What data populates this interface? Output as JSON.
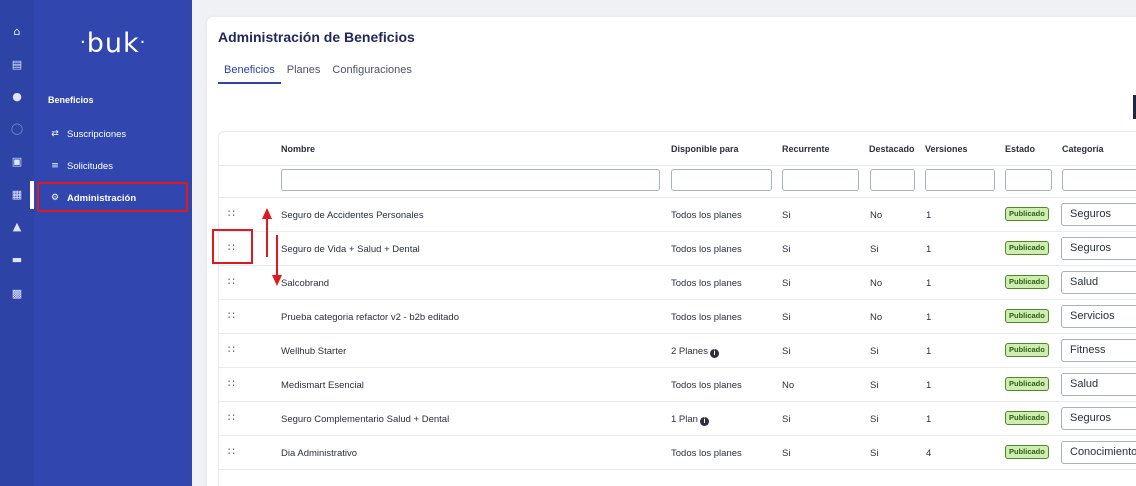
{
  "rail": {
    "icons": [
      "home-icon",
      "document-icon",
      "dollar-icon",
      "clock-icon",
      "puzzle-icon",
      "briefcase-icon",
      "graduation-icon",
      "folder-icon",
      "store-icon"
    ]
  },
  "sidebar": {
    "logo": "buk",
    "section_title": "Beneficios",
    "items": [
      {
        "label": "Suscripciones",
        "icon": "swap-icon"
      },
      {
        "label": "Solicitudes",
        "icon": "list-icon"
      },
      {
        "label": "Administración",
        "icon": "gear-icon"
      }
    ]
  },
  "page": {
    "title": "Administración de Beneficios",
    "tabs": [
      "Beneficios",
      "Planes",
      "Configuraciones"
    ],
    "active_tab": "Beneficios"
  },
  "table": {
    "headers": {
      "nombre": "Nombre",
      "disponible": "Disponible para",
      "recurrente": "Recurrente",
      "destacado": "Destacado",
      "versiones": "Versiones",
      "estado": "Estado",
      "categoria": "Categoría"
    },
    "rows": [
      {
        "nombre": "Seguro de Accidentes Personales",
        "disponible": "Todos los planes",
        "info": false,
        "recurrente": "Si",
        "destacado": "No",
        "versiones": "1",
        "estado": "Publicado",
        "categoria": "Seguros"
      },
      {
        "nombre": "Seguro de Vida + Salud + Dental",
        "disponible": "Todos los planes",
        "info": false,
        "recurrente": "Si",
        "destacado": "Si",
        "versiones": "1",
        "estado": "Publicado",
        "categoria": "Seguros"
      },
      {
        "nombre": "Salcobrand",
        "disponible": "Todos los planes",
        "info": false,
        "recurrente": "Si",
        "destacado": "No",
        "versiones": "1",
        "estado": "Publicado",
        "categoria": "Salud"
      },
      {
        "nombre": "Prueba categoria refactor v2 - b2b editado",
        "disponible": "Todos los planes",
        "info": false,
        "recurrente": "Si",
        "destacado": "No",
        "versiones": "1",
        "estado": "Publicado",
        "categoria": "Servicios"
      },
      {
        "nombre": "Wellhub Starter",
        "disponible": "2 Planes",
        "info": true,
        "recurrente": "Si",
        "destacado": "Si",
        "versiones": "1",
        "estado": "Publicado",
        "categoria": "Fitness"
      },
      {
        "nombre": "Medismart Esencial",
        "disponible": "Todos los planes",
        "info": false,
        "recurrente": "No",
        "destacado": "Si",
        "versiones": "1",
        "estado": "Publicado",
        "categoria": "Salud"
      },
      {
        "nombre": "Seguro Complementario Salud + Dental",
        "disponible": "1 Plan",
        "info": true,
        "recurrente": "Si",
        "destacado": "Si",
        "versiones": "1",
        "estado": "Publicado",
        "categoria": "Seguros"
      },
      {
        "nombre": "Dia Administrativo",
        "disponible": "Todos los planes",
        "info": false,
        "recurrente": "Si",
        "destacado": "Si",
        "versiones": "4",
        "estado": "Publicado",
        "categoria": "Conocimiento"
      }
    ]
  },
  "colors": {
    "brand": "#3147af",
    "annotation": "#e0191f",
    "badge_bg": "#cdeeb0",
    "badge_border": "#4c8a22"
  }
}
